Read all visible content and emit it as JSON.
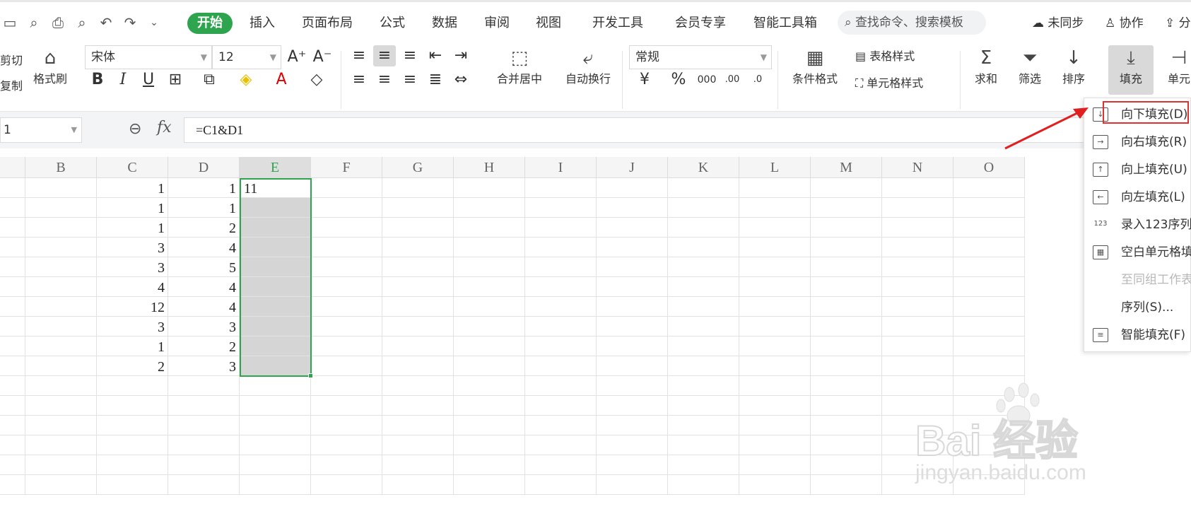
{
  "tabs": {
    "active": "开始",
    "items": [
      "插入",
      "页面布局",
      "公式",
      "数据",
      "审阅",
      "视图",
      "开发工具",
      "会员专享",
      "智能工具箱"
    ]
  },
  "search": {
    "placeholder": "查找命令、搜索模板"
  },
  "topright": {
    "sync": "未同步",
    "collab": "协作",
    "share": "分"
  },
  "ribbon": {
    "cut": "剪切",
    "copy": "复制",
    "format_painter": "格式刷",
    "font_name": "宋体",
    "font_size": "12",
    "merge_center": "合并居中",
    "wrap_text": "自动换行",
    "number_format": "常规",
    "conditional_format": "条件格式",
    "table_style": "表格样式",
    "cell_style": "单元格样式",
    "sum": "求和",
    "filter": "筛选",
    "sort": "排序",
    "fill": "填充",
    "cell": "单元"
  },
  "formula_bar": {
    "name_box": "1",
    "fx": "fx",
    "formula": "=C1&D1"
  },
  "columns": [
    "B",
    "C",
    "D",
    "E",
    "F",
    "G",
    "H",
    "I",
    "J",
    "K",
    "L",
    "M",
    "N",
    "O"
  ],
  "rows": [
    {
      "c": "1",
      "d": "1",
      "e": "11"
    },
    {
      "c": "1",
      "d": "1",
      "e": ""
    },
    {
      "c": "1",
      "d": "2",
      "e": ""
    },
    {
      "c": "3",
      "d": "4",
      "e": ""
    },
    {
      "c": "3",
      "d": "5",
      "e": ""
    },
    {
      "c": "4",
      "d": "4",
      "e": ""
    },
    {
      "c": "12",
      "d": "4",
      "e": ""
    },
    {
      "c": "3",
      "d": "3",
      "e": ""
    },
    {
      "c": "1",
      "d": "2",
      "e": ""
    },
    {
      "c": "2",
      "d": "3",
      "e": ""
    }
  ],
  "fill_menu": [
    {
      "label": "向下填充(D)",
      "icon": "fill-down-icon",
      "enabled": true
    },
    {
      "label": "向右填充(R)",
      "icon": "fill-right-icon",
      "enabled": true
    },
    {
      "label": "向上填充(U)",
      "icon": "fill-up-icon",
      "enabled": true
    },
    {
      "label": "向左填充(L)",
      "icon": "fill-left-icon",
      "enabled": true
    },
    {
      "label": "录入123序列",
      "icon": "sequence-123-icon",
      "enabled": true
    },
    {
      "label": "空白单元格填",
      "icon": "blank-cell-fill-icon",
      "enabled": true
    },
    {
      "label": "至同组工作表",
      "icon": "",
      "enabled": false
    },
    {
      "label": "序列(S)...",
      "icon": "",
      "enabled": true
    },
    {
      "label": "智能填充(F)",
      "icon": "smart-fill-icon",
      "enabled": true
    }
  ],
  "watermark": {
    "brand": "Bai  经验",
    "url": "jingyan.baidu.com"
  },
  "colors": {
    "accent": "#2ea44f",
    "highlight_red": "#e03030",
    "selection_shade": "#d5d5d5"
  }
}
